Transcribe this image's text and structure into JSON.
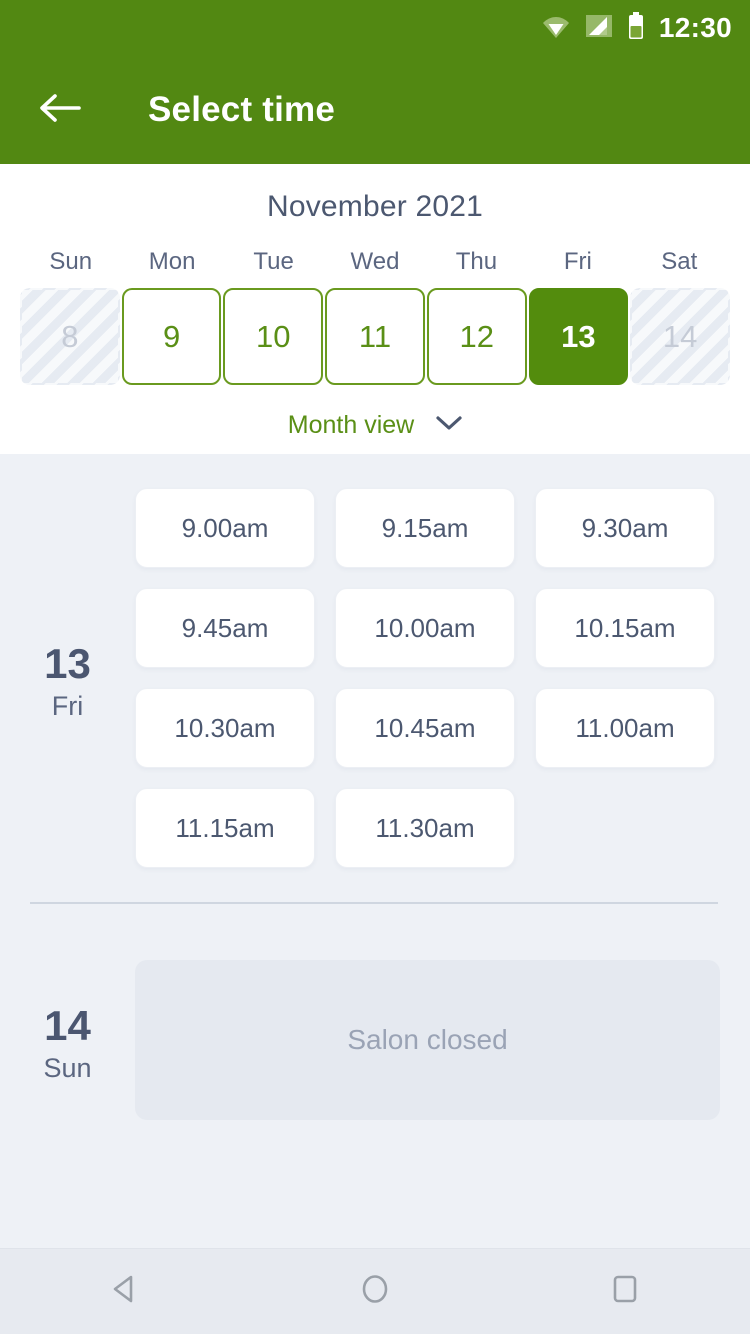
{
  "status_bar": {
    "time": "12:30",
    "icons": [
      "wifi-icon",
      "cellular-signal-icon",
      "battery-icon"
    ]
  },
  "app_bar": {
    "title": "Select time",
    "back_icon": "back-arrow-icon"
  },
  "calendar": {
    "month_title": "November 2021",
    "weekdays": [
      "Sun",
      "Mon",
      "Tue",
      "Wed",
      "Thu",
      "Fri",
      "Sat"
    ],
    "days": [
      {
        "number": "8",
        "state": "disabled"
      },
      {
        "number": "9",
        "state": "available"
      },
      {
        "number": "10",
        "state": "available"
      },
      {
        "number": "11",
        "state": "available"
      },
      {
        "number": "12",
        "state": "available"
      },
      {
        "number": "13",
        "state": "selected"
      },
      {
        "number": "14",
        "state": "disabled"
      }
    ],
    "month_view_label": "Month view",
    "month_view_chevron": "chevron-down-icon"
  },
  "schedule": [
    {
      "day_number": "13",
      "day_name": "Fri",
      "slots": [
        "9.00am",
        "9.15am",
        "9.30am",
        "9.45am",
        "10.00am",
        "10.15am",
        "10.30am",
        "10.45am",
        "11.00am",
        "11.15am",
        "11.30am"
      ]
    },
    {
      "day_number": "14",
      "day_name": "Sun",
      "closed_message": "Salon closed"
    }
  ],
  "nav_bar": {
    "back": "nav-back-icon",
    "home": "nav-home-icon",
    "recents": "nav-recents-icon"
  },
  "colors": {
    "brand_green": "#528812",
    "selected_green": "#538c0d",
    "body_bg": "#eef1f6",
    "text_dark": "#4c5870",
    "text_muted": "#9aa3b5"
  }
}
